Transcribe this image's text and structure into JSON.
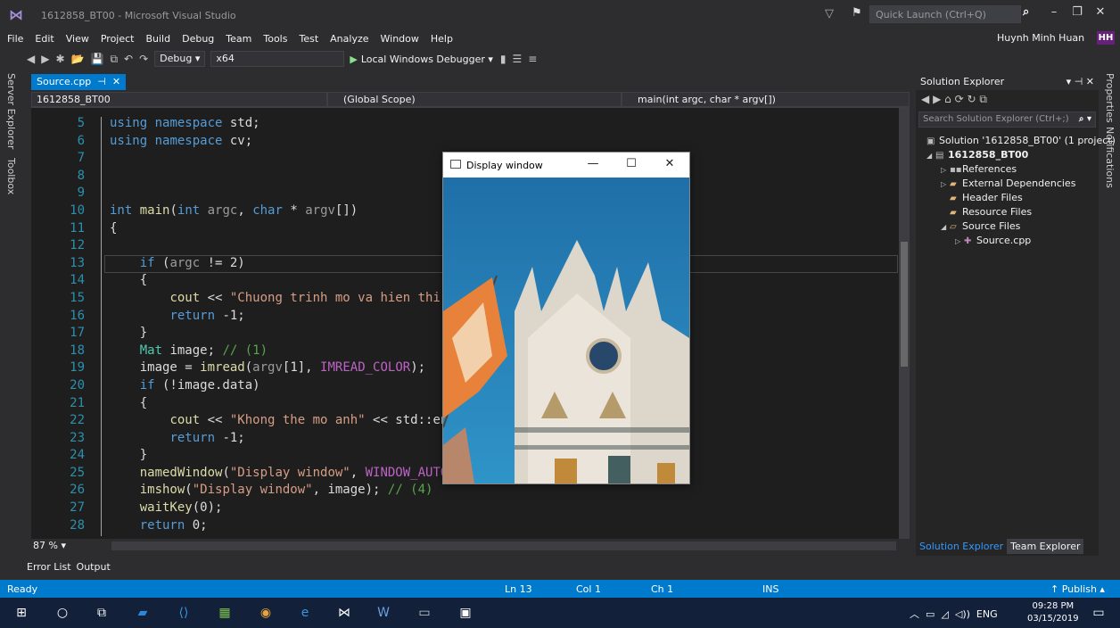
{
  "window_title": "1612858_BT00 - Microsoft Visual Studio",
  "quick_launch_placeholder": "Quick Launch (Ctrl+Q)",
  "menu": [
    "File",
    "Edit",
    "View",
    "Project",
    "Build",
    "Debug",
    "Team",
    "Tools",
    "Test",
    "Analyze",
    "Window",
    "Help"
  ],
  "user": {
    "name": "Huynh Minh Huan",
    "initials": "HH"
  },
  "toolbar": {
    "config": "Debug",
    "platform": "x64",
    "debugger_label": "Local Windows Debugger"
  },
  "side_tabs": {
    "server_explorer": "Server Explorer",
    "toolbox": "Toolbox",
    "properties": "Properties",
    "notifications": "Notifications"
  },
  "document_tab": {
    "label": "Source.cpp"
  },
  "nav": {
    "project": "1612858_BT00",
    "scope": "(Global Scope)",
    "member": "main(int argc, char * argv[])"
  },
  "editor": {
    "line_numbers": [
      "5",
      "6",
      "7",
      "8",
      "9",
      "10",
      "11",
      "12",
      "13",
      "14",
      "15",
      "16",
      "17",
      "18",
      "19",
      "20",
      "21",
      "22",
      "23",
      "24",
      "25",
      "26",
      "27",
      "28"
    ]
  },
  "zoom_level": "87 %",
  "bottom_tabs": [
    "Error List",
    "Output"
  ],
  "solution_explorer": {
    "title": "Solution Explorer",
    "search_placeholder": "Search Solution Explorer (Ctrl+;)",
    "items": [
      {
        "label": "Solution '1612858_BT00' (1 project)"
      },
      {
        "label": "1612858_BT00"
      },
      {
        "label": "References"
      },
      {
        "label": "External Dependencies"
      },
      {
        "label": "Header Files"
      },
      {
        "label": "Resource Files"
      },
      {
        "label": "Source Files"
      },
      {
        "label": "Source.cpp"
      }
    ],
    "footer_tabs": [
      "Solution Explorer",
      "Team Explorer"
    ]
  },
  "statusbar": {
    "state": "Ready",
    "ln": "Ln 13",
    "col": "Col 1",
    "ch": "Ch 1",
    "mode": "INS",
    "publish": "Publish"
  },
  "taskbar": {
    "lang": "ENG",
    "time": "09:28 PM",
    "date": "03/15/2019"
  },
  "display_window": {
    "title": "Display window"
  }
}
